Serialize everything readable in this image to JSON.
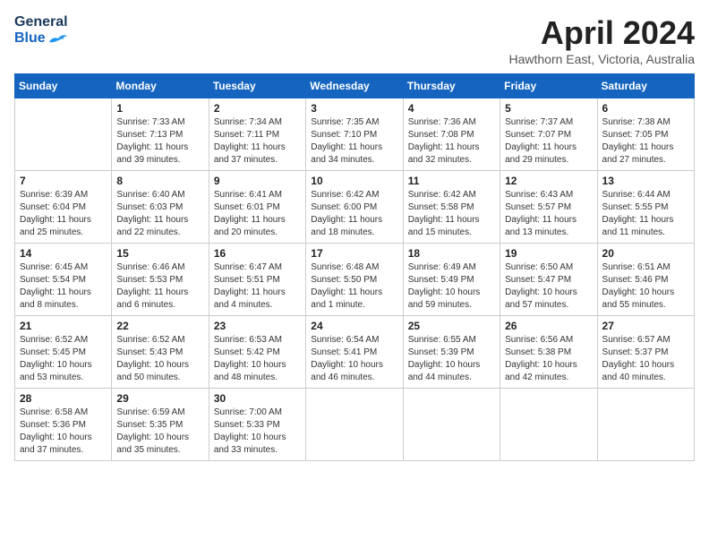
{
  "header": {
    "logo_general": "General",
    "logo_blue": "Blue",
    "month_title": "April 2024",
    "location": "Hawthorn East, Victoria, Australia"
  },
  "weekdays": [
    "Sunday",
    "Monday",
    "Tuesday",
    "Wednesday",
    "Thursday",
    "Friday",
    "Saturday"
  ],
  "weeks": [
    [
      {
        "day": "",
        "info": ""
      },
      {
        "day": "1",
        "info": "Sunrise: 7:33 AM\nSunset: 7:13 PM\nDaylight: 11 hours\nand 39 minutes."
      },
      {
        "day": "2",
        "info": "Sunrise: 7:34 AM\nSunset: 7:11 PM\nDaylight: 11 hours\nand 37 minutes."
      },
      {
        "day": "3",
        "info": "Sunrise: 7:35 AM\nSunset: 7:10 PM\nDaylight: 11 hours\nand 34 minutes."
      },
      {
        "day": "4",
        "info": "Sunrise: 7:36 AM\nSunset: 7:08 PM\nDaylight: 11 hours\nand 32 minutes."
      },
      {
        "day": "5",
        "info": "Sunrise: 7:37 AM\nSunset: 7:07 PM\nDaylight: 11 hours\nand 29 minutes."
      },
      {
        "day": "6",
        "info": "Sunrise: 7:38 AM\nSunset: 7:05 PM\nDaylight: 11 hours\nand 27 minutes."
      }
    ],
    [
      {
        "day": "7",
        "info": "Sunrise: 6:39 AM\nSunset: 6:04 PM\nDaylight: 11 hours\nand 25 minutes."
      },
      {
        "day": "8",
        "info": "Sunrise: 6:40 AM\nSunset: 6:03 PM\nDaylight: 11 hours\nand 22 minutes."
      },
      {
        "day": "9",
        "info": "Sunrise: 6:41 AM\nSunset: 6:01 PM\nDaylight: 11 hours\nand 20 minutes."
      },
      {
        "day": "10",
        "info": "Sunrise: 6:42 AM\nSunset: 6:00 PM\nDaylight: 11 hours\nand 18 minutes."
      },
      {
        "day": "11",
        "info": "Sunrise: 6:42 AM\nSunset: 5:58 PM\nDaylight: 11 hours\nand 15 minutes."
      },
      {
        "day": "12",
        "info": "Sunrise: 6:43 AM\nSunset: 5:57 PM\nDaylight: 11 hours\nand 13 minutes."
      },
      {
        "day": "13",
        "info": "Sunrise: 6:44 AM\nSunset: 5:55 PM\nDaylight: 11 hours\nand 11 minutes."
      }
    ],
    [
      {
        "day": "14",
        "info": "Sunrise: 6:45 AM\nSunset: 5:54 PM\nDaylight: 11 hours\nand 8 minutes."
      },
      {
        "day": "15",
        "info": "Sunrise: 6:46 AM\nSunset: 5:53 PM\nDaylight: 11 hours\nand 6 minutes."
      },
      {
        "day": "16",
        "info": "Sunrise: 6:47 AM\nSunset: 5:51 PM\nDaylight: 11 hours\nand 4 minutes."
      },
      {
        "day": "17",
        "info": "Sunrise: 6:48 AM\nSunset: 5:50 PM\nDaylight: 11 hours\nand 1 minute."
      },
      {
        "day": "18",
        "info": "Sunrise: 6:49 AM\nSunset: 5:49 PM\nDaylight: 10 hours\nand 59 minutes."
      },
      {
        "day": "19",
        "info": "Sunrise: 6:50 AM\nSunset: 5:47 PM\nDaylight: 10 hours\nand 57 minutes."
      },
      {
        "day": "20",
        "info": "Sunrise: 6:51 AM\nSunset: 5:46 PM\nDaylight: 10 hours\nand 55 minutes."
      }
    ],
    [
      {
        "day": "21",
        "info": "Sunrise: 6:52 AM\nSunset: 5:45 PM\nDaylight: 10 hours\nand 53 minutes."
      },
      {
        "day": "22",
        "info": "Sunrise: 6:52 AM\nSunset: 5:43 PM\nDaylight: 10 hours\nand 50 minutes."
      },
      {
        "day": "23",
        "info": "Sunrise: 6:53 AM\nSunset: 5:42 PM\nDaylight: 10 hours\nand 48 minutes."
      },
      {
        "day": "24",
        "info": "Sunrise: 6:54 AM\nSunset: 5:41 PM\nDaylight: 10 hours\nand 46 minutes."
      },
      {
        "day": "25",
        "info": "Sunrise: 6:55 AM\nSunset: 5:39 PM\nDaylight: 10 hours\nand 44 minutes."
      },
      {
        "day": "26",
        "info": "Sunrise: 6:56 AM\nSunset: 5:38 PM\nDaylight: 10 hours\nand 42 minutes."
      },
      {
        "day": "27",
        "info": "Sunrise: 6:57 AM\nSunset: 5:37 PM\nDaylight: 10 hours\nand 40 minutes."
      }
    ],
    [
      {
        "day": "28",
        "info": "Sunrise: 6:58 AM\nSunset: 5:36 PM\nDaylight: 10 hours\nand 37 minutes."
      },
      {
        "day": "29",
        "info": "Sunrise: 6:59 AM\nSunset: 5:35 PM\nDaylight: 10 hours\nand 35 minutes."
      },
      {
        "day": "30",
        "info": "Sunrise: 7:00 AM\nSunset: 5:33 PM\nDaylight: 10 hours\nand 33 minutes."
      },
      {
        "day": "",
        "info": ""
      },
      {
        "day": "",
        "info": ""
      },
      {
        "day": "",
        "info": ""
      },
      {
        "day": "",
        "info": ""
      }
    ]
  ]
}
